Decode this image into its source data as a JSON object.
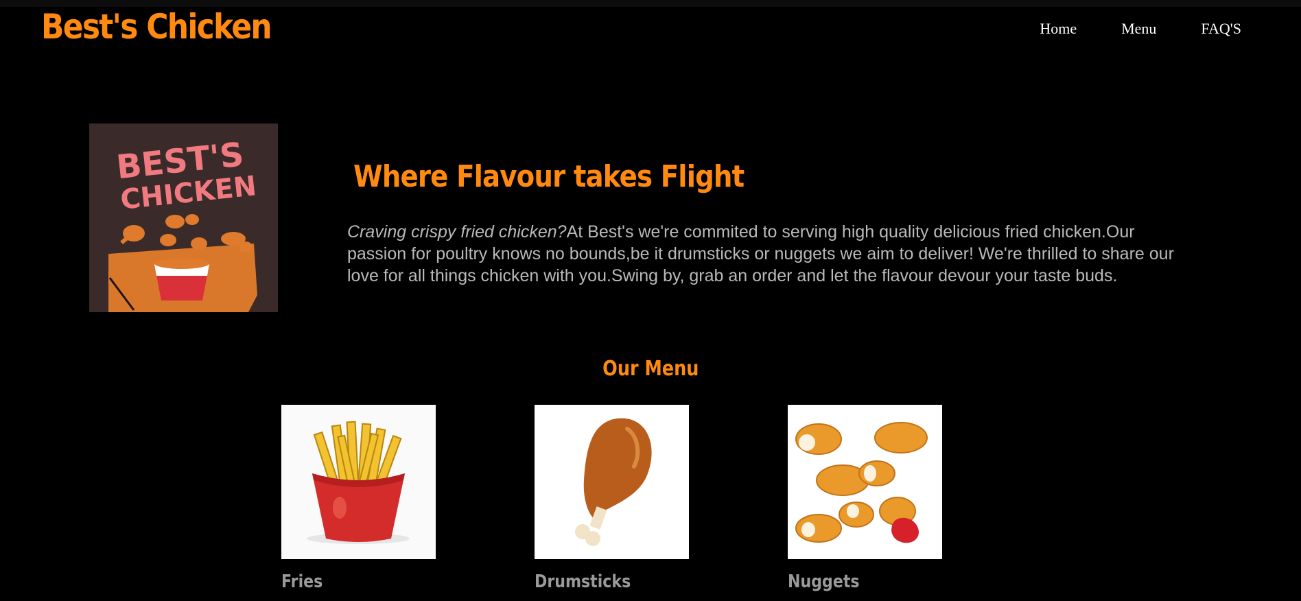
{
  "header": {
    "brand": "Best's Chicken",
    "nav": [
      "Home",
      "Menu",
      "FAQ'S"
    ]
  },
  "logo": {
    "line1": "BEST'S",
    "line2": "CHICKEN"
  },
  "hero": {
    "title": "Where Flavour takes Flight",
    "text_italic": "Craving crispy fried chicken?",
    "text_rest": "At Best's we're commited to serving high quality delicious fried chicken.Our passion for poultry knows no bounds,be it drumsticks or nuggets we aim to deliver! We're thrilled to share our love for all things chicken with you.Swing by, grab an order and let the flavour devour your taste buds."
  },
  "menu": {
    "title": "Our Menu",
    "items": [
      {
        "name": "Fries",
        "icon": "fries-icon"
      },
      {
        "name": "Drumsticks",
        "icon": "drumstick-icon"
      },
      {
        "name": "Nuggets",
        "icon": "nuggets-icon"
      }
    ]
  },
  "colors": {
    "accent": "#ff8a0f",
    "background": "#000000",
    "text": "#b9b9b9"
  }
}
